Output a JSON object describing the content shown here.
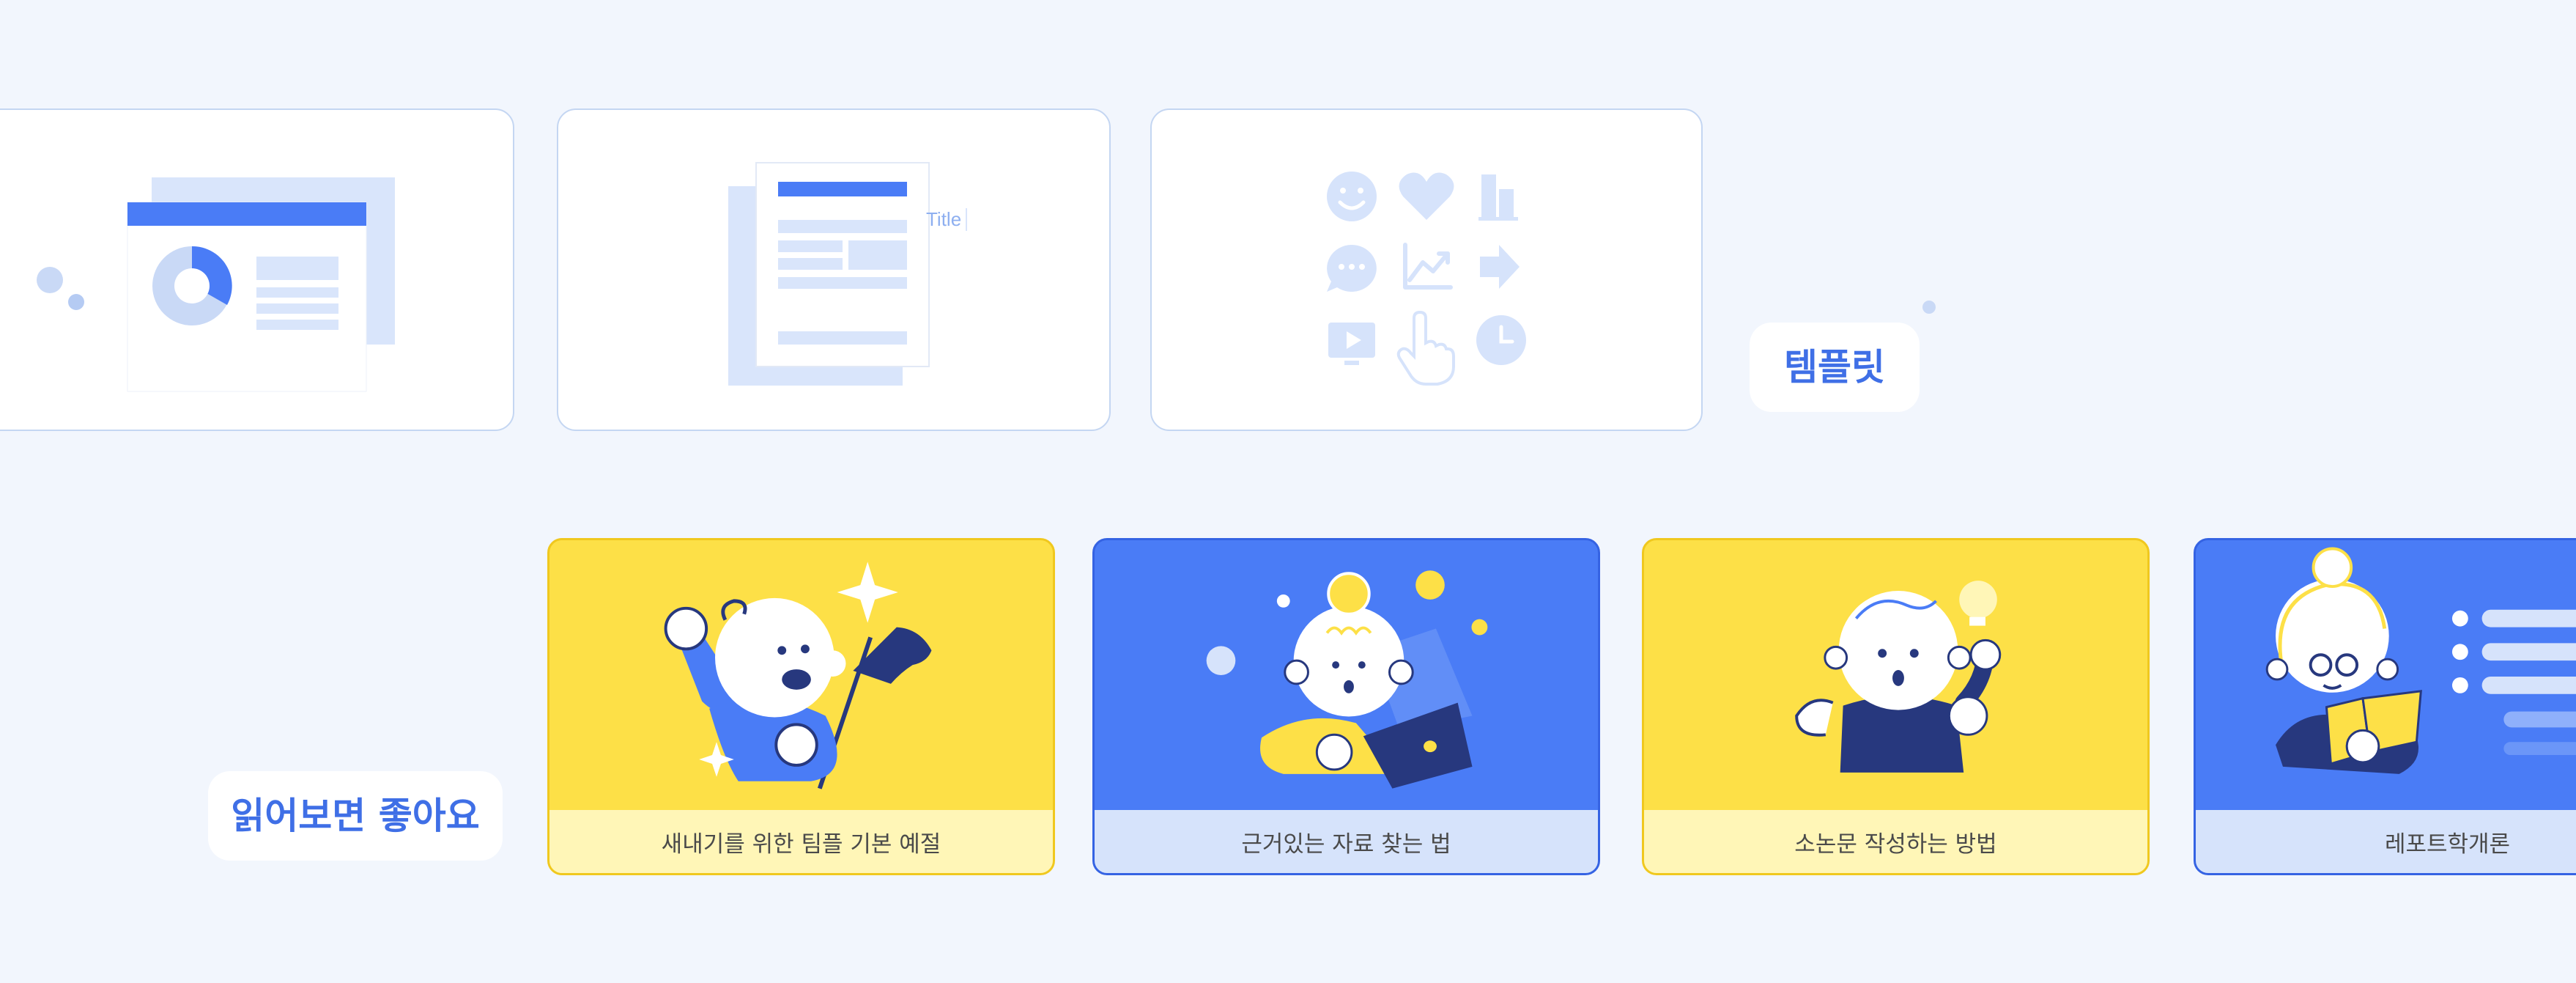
{
  "templates": {
    "tag_label": "템플릿",
    "cards": [
      {
        "name": "presentation-template",
        "title_hint": ""
      },
      {
        "name": "document-template",
        "title_hint": "Title"
      },
      {
        "name": "icon-set-template",
        "title_hint": ""
      }
    ]
  },
  "reading": {
    "tag_label": "읽어보면 좋아요",
    "cards": [
      {
        "caption": "새내기를 위한 팀플 기본 예절",
        "theme": "yellow"
      },
      {
        "caption": "근거있는 자료 찾는 법",
        "theme": "blue"
      },
      {
        "caption": "소논문 작성하는 방법",
        "theme": "yellow"
      },
      {
        "caption": "레포트학개론",
        "theme": "blue"
      }
    ]
  },
  "colors": {
    "background": "#f2f6fd",
    "accent": "#4a7cf6",
    "yellow": "#fde047",
    "navy": "#27387e",
    "light_blue": "#d6e3fb"
  }
}
